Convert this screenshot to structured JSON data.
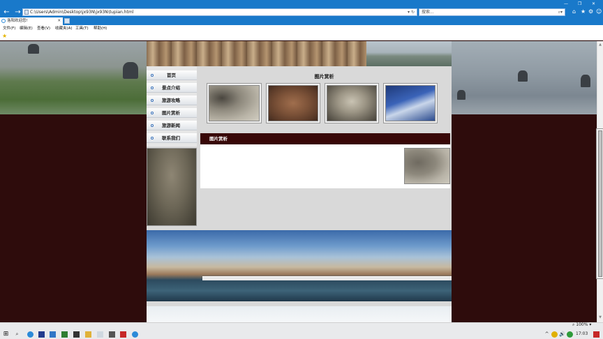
{
  "browser": {
    "address": "C:\\Users\\Admin\\Desktop\\jx93N\\jx93N\\tupian.html",
    "search_placeholder": "搜索...",
    "tab_title": "洛阳欢迎您!",
    "menu": [
      "文件(F)",
      "编辑(E)",
      "查看(V)",
      "收藏夹(A)",
      "工具(T)",
      "帮助(H)"
    ]
  },
  "site": {
    "nav": [
      "首页",
      "景点介绍",
      "旅游攻略",
      "图片赏析",
      "旅游新闻",
      "联系我们"
    ],
    "gallery_title": "图片赏析",
    "section_bar": "图片赏析"
  },
  "status": {
    "zoom": "100%",
    "time": "17:03"
  },
  "colors": {
    "page_background": "#2e0c0c",
    "section_bar": "#380707",
    "browser_blue": "#1979ca"
  }
}
